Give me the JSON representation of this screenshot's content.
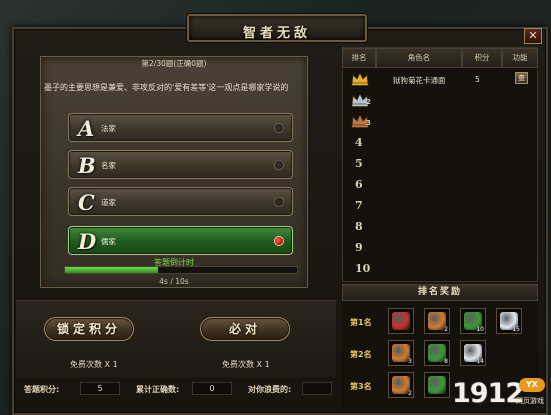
{
  "window": {
    "title": "智者无敌",
    "close_label": "✕"
  },
  "quiz": {
    "counter": "第2/30题(正确0题)",
    "question": "墨子的主要思想是兼爱、非攻反对的'爱有差等'这一观点是哪家学说的",
    "options": [
      {
        "letter": "A",
        "label": "法家",
        "selected": false
      },
      {
        "letter": "B",
        "label": "名家",
        "selected": false
      },
      {
        "letter": "C",
        "label": "道家",
        "selected": false
      },
      {
        "letter": "D",
        "label": "儒家",
        "selected": true
      }
    ],
    "answer_correct": "答题倒计时",
    "progress": 0.4,
    "timer": "4s / 10s"
  },
  "actions": {
    "lock_score_label": "锁定积分",
    "must_right_label": "必对",
    "free_times_left": "免费次数 X 1",
    "free_times_right": "免费次数 X 1"
  },
  "score_bar": {
    "score_label": "答题积分:",
    "score_value": "5",
    "correct_label": "累计正确数:",
    "correct_value": "0",
    "damage_label": "对你浪费的:"
  },
  "rank": {
    "headers": [
      "排名",
      "角色名",
      "积分",
      "功能"
    ],
    "rows": [
      {
        "rank": "1",
        "name": "狱狗菊花卡通面",
        "score": "5",
        "func": "查",
        "crown": "gold"
      },
      {
        "rank": "2",
        "name": "",
        "score": "",
        "func": "",
        "crown": "silver"
      },
      {
        "rank": "3",
        "name": "",
        "score": "",
        "func": "",
        "crown": "bronze"
      },
      {
        "rank": "4",
        "name": "",
        "score": "",
        "func": ""
      },
      {
        "rank": "5",
        "name": "",
        "score": "",
        "func": ""
      },
      {
        "rank": "6",
        "name": "",
        "score": "",
        "func": ""
      },
      {
        "rank": "7",
        "name": "",
        "score": "",
        "func": ""
      },
      {
        "rank": "8",
        "name": "",
        "score": "",
        "func": ""
      },
      {
        "rank": "9",
        "name": "",
        "score": "",
        "func": ""
      },
      {
        "rank": "10",
        "name": "",
        "score": "",
        "func": ""
      }
    ]
  },
  "rewards": {
    "title": "排名奖励",
    "tiers": [
      {
        "label": "第1名",
        "items": [
          {
            "icon": "firecracker-icon",
            "color": "#c0302a",
            "count": ""
          },
          {
            "icon": "scroll-icon",
            "color": "#d07a30",
            "count": "2"
          },
          {
            "icon": "gourd-icon",
            "color": "#3a9a3a",
            "count": "10"
          },
          {
            "icon": "feather-icon",
            "color": "#e0e8f0",
            "count": "15"
          }
        ]
      },
      {
        "label": "第2名",
        "items": [
          {
            "icon": "scroll-icon",
            "color": "#d07a30",
            "count": "3"
          },
          {
            "icon": "gourd-icon",
            "color": "#3a9a3a",
            "count": "8"
          },
          {
            "icon": "feather-icon",
            "color": "#e0e8f0",
            "count": "14"
          }
        ]
      },
      {
        "label": "第3名",
        "items": [
          {
            "icon": "scroll-icon",
            "color": "#d07a30",
            "count": "2"
          },
          {
            "icon": "gourd-icon",
            "color": "#3a9a3a",
            "count": ""
          }
        ]
      }
    ]
  },
  "watermark": {
    "number": "1912",
    "badge": "YX",
    "sub": "网页游戏"
  }
}
